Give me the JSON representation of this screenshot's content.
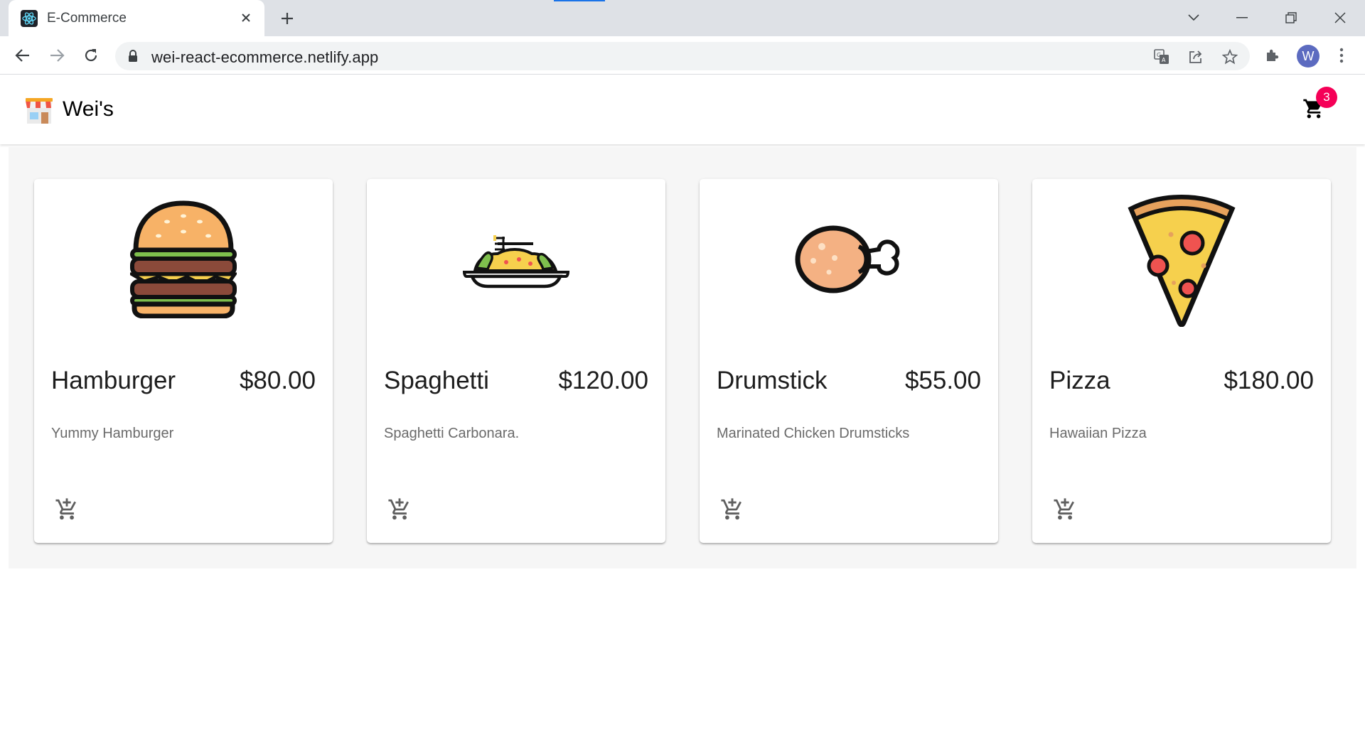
{
  "browser": {
    "tab_title": "E-Commerce",
    "url": "wei-react-ecommerce.netlify.app",
    "profile_initial": "W",
    "accent": "#1a73e8"
  },
  "app": {
    "brand": "Wei's",
    "cart_count": "3",
    "badge_color": "#f50057"
  },
  "products": [
    {
      "name": "Hamburger",
      "price": "$80.00",
      "description": "Yummy Hamburger",
      "icon": "hamburger-icon"
    },
    {
      "name": "Spaghetti",
      "price": "$120.00",
      "description": "Spaghetti Carbonara.",
      "icon": "spaghetti-icon"
    },
    {
      "name": "Drumstick",
      "price": "$55.00",
      "description": "Marinated Chicken Drumsticks",
      "icon": "drumstick-icon"
    },
    {
      "name": "Pizza",
      "price": "$180.00",
      "description": "Hawaiian Pizza",
      "icon": "pizza-icon"
    }
  ]
}
